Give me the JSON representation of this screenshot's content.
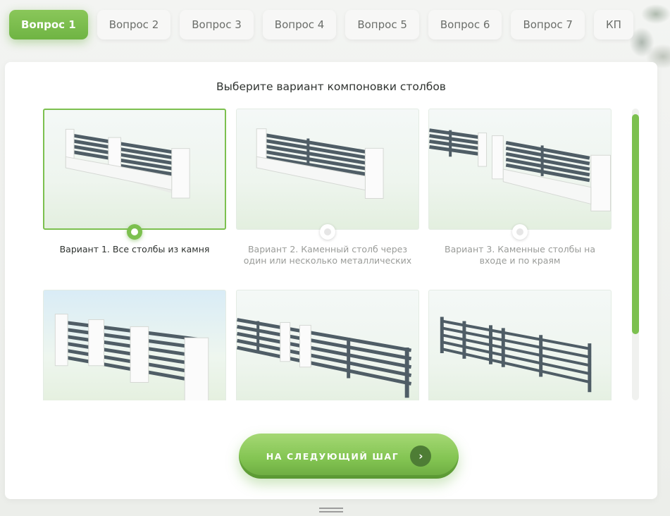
{
  "tabs": [
    {
      "label": "Вопрос 1",
      "active": true
    },
    {
      "label": "Вопрос 2",
      "active": false
    },
    {
      "label": "Вопрос 3",
      "active": false
    },
    {
      "label": "Вопрос 4",
      "active": false
    },
    {
      "label": "Вопрос 5",
      "active": false
    },
    {
      "label": "Вопрос 6",
      "active": false
    },
    {
      "label": "Вопрос 7",
      "active": false
    },
    {
      "label": "КП",
      "active": false
    }
  ],
  "main": {
    "title": "Выберите вариант компоновки столбов",
    "options": [
      {
        "label": "Вариант 1. Все столбы из камня",
        "selected": true
      },
      {
        "label": "Вариант 2. Каменный столб через один или несколько металлических",
        "selected": false
      },
      {
        "label": "Вариант 3. Каменные столбы на входе и по краям",
        "selected": false
      },
      {
        "label": "",
        "selected": false
      },
      {
        "label": "",
        "selected": false
      },
      {
        "label": "",
        "selected": false
      }
    ],
    "next_button": {
      "label": "НА СЛЕДУЮЩИЙ ШАГ",
      "icon": "chevron-right-icon"
    }
  },
  "colors": {
    "accent": "#7cc04f",
    "text": "#2f3330",
    "muted": "#9a9c99",
    "metal": "#4f5d66"
  }
}
